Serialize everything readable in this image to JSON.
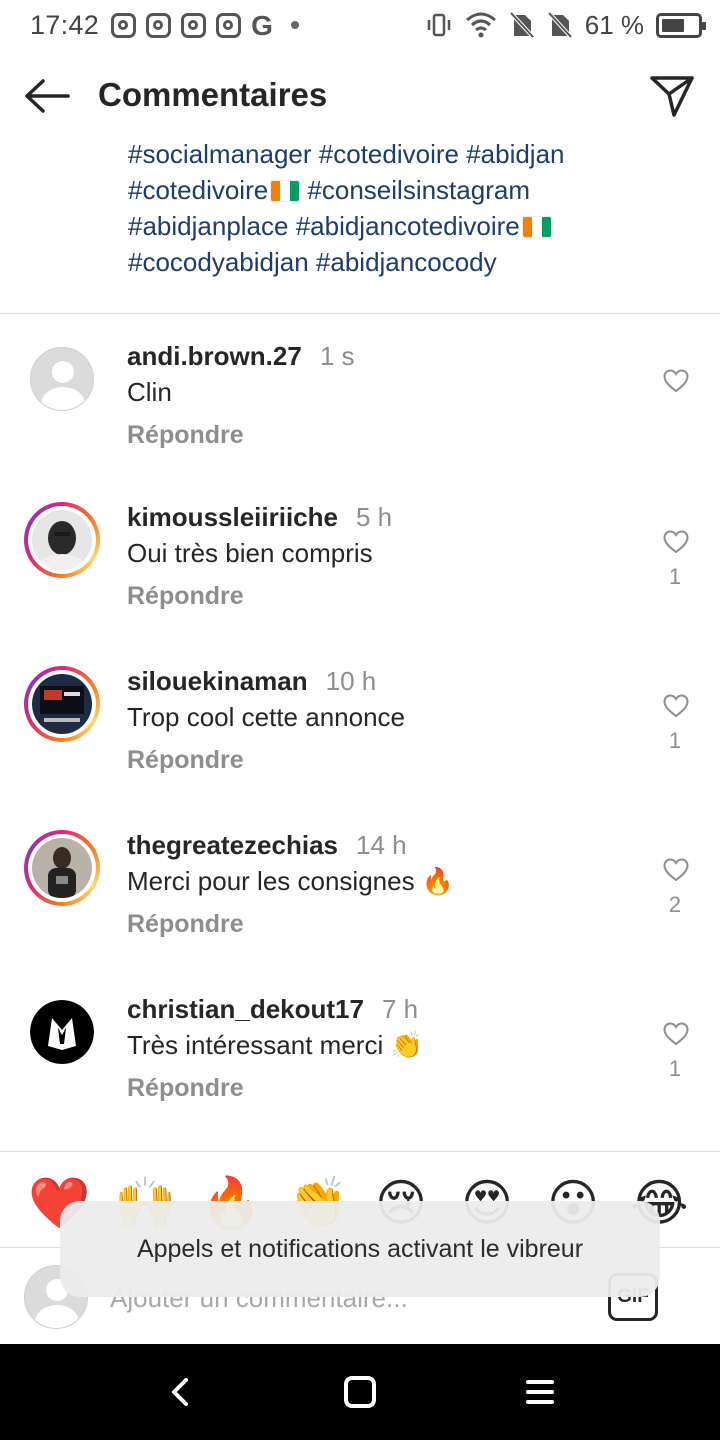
{
  "status_bar": {
    "time": "17:42",
    "apps": [
      "instagram-icon",
      "instagram-icon",
      "instagram-icon",
      "instagram-icon"
    ],
    "google": "G",
    "battery_text": "61 %"
  },
  "header": {
    "title": "Commentaires"
  },
  "caption": {
    "lines": [
      "#socialmanager #cotedivoire #abidjan",
      "#cotedivoire",
      " #conseilsinstagram",
      "#abidjanplace #abidjancotedivoire",
      "#cocodyabidjan #abidjancocody"
    ]
  },
  "comments": [
    {
      "username": "andi.brown.27",
      "time": "1 s",
      "text": "Clin",
      "reply": "Répondre",
      "likes": ""
    },
    {
      "username": "kimoussleiiriiche",
      "time": "5 h",
      "text": "Oui très bien compris",
      "reply": "Répondre",
      "likes": "1"
    },
    {
      "username": "silouekinaman",
      "time": "10 h",
      "text": "Trop cool cette annonce",
      "reply": "Répondre",
      "likes": "1"
    },
    {
      "username": "thegreatezechias",
      "time": "14 h",
      "text": "Merci pour les consignes 🔥",
      "reply": "Répondre",
      "likes": "2"
    },
    {
      "username": "christian_dekout17",
      "time": "7 h",
      "text": "Très intéressant merci 👏",
      "reply": "Répondre",
      "likes": "1"
    }
  ],
  "emoji_bar": [
    "❤️",
    "🙌",
    "🔥",
    "👏",
    "😢",
    "😍",
    "😮",
    "😂"
  ],
  "composer": {
    "placeholder": "Ajouter un commentaire...",
    "gif_label": "GIF"
  },
  "toast": {
    "text": "Appels et notifications activant le vibreur"
  },
  "colors": {
    "hashtag": "#1c3d6e",
    "muted": "#8e8e8e",
    "text": "#262626"
  }
}
